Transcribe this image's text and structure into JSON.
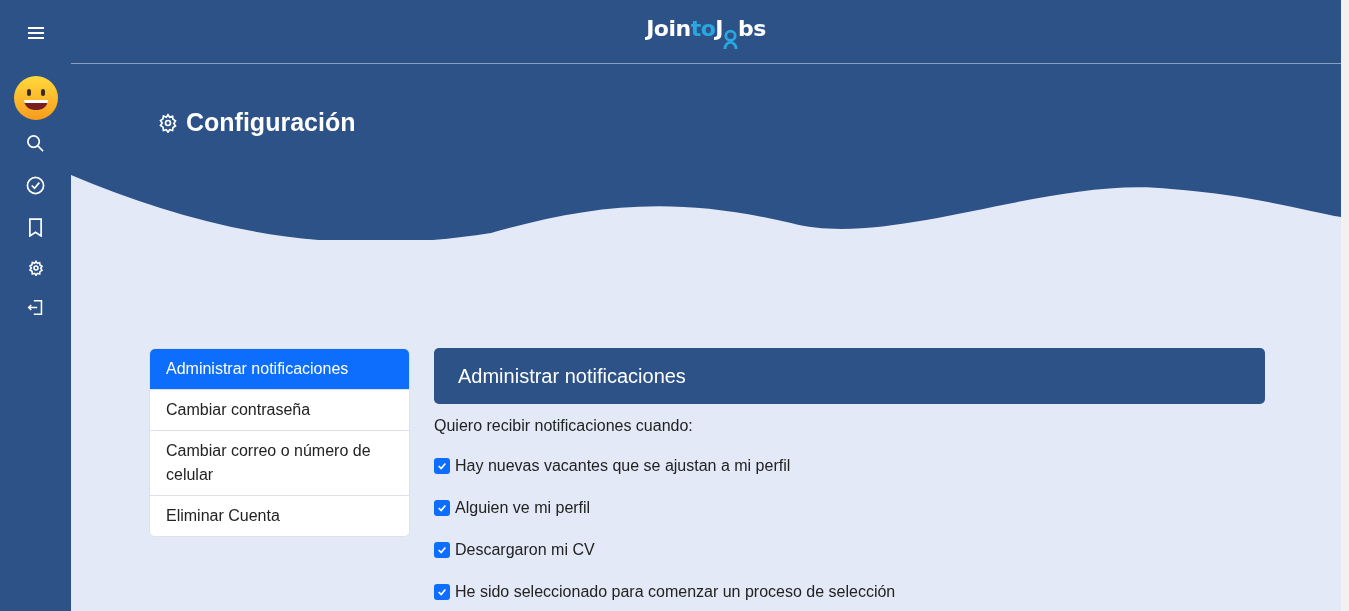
{
  "logo": {
    "parts": [
      {
        "text": "Join",
        "accent": false
      },
      {
        "text": "to",
        "accent": true
      },
      {
        "text": "J",
        "accent": false
      },
      {
        "text": "bs",
        "accent": false
      }
    ]
  },
  "sidebar": {
    "items": [
      {
        "kind": "search"
      },
      {
        "kind": "check"
      },
      {
        "kind": "bookmark"
      },
      {
        "kind": "settings"
      },
      {
        "kind": "logout"
      }
    ]
  },
  "page": {
    "title": "Configuración"
  },
  "menu": {
    "items": [
      {
        "label": "Administrar notificaciones",
        "selected": true
      },
      {
        "label": "Cambiar contraseña",
        "selected": false
      },
      {
        "label": "Cambiar correo o número de celular",
        "selected": false
      },
      {
        "label": "Eliminar Cuenta",
        "selected": false
      }
    ]
  },
  "panel": {
    "title": "Administrar notificaciones",
    "intro": "Quiero recibir notificaciones cuando:",
    "options": [
      {
        "label": "Hay nuevas vacantes que se ajustan a mi perfil",
        "checked": true
      },
      {
        "label": "Alguien ve mi perfil",
        "checked": true
      },
      {
        "label": "Descargaron mi CV",
        "checked": true
      },
      {
        "label": "He sido seleccionado para comenzar un proceso de selección",
        "checked": true
      }
    ]
  }
}
